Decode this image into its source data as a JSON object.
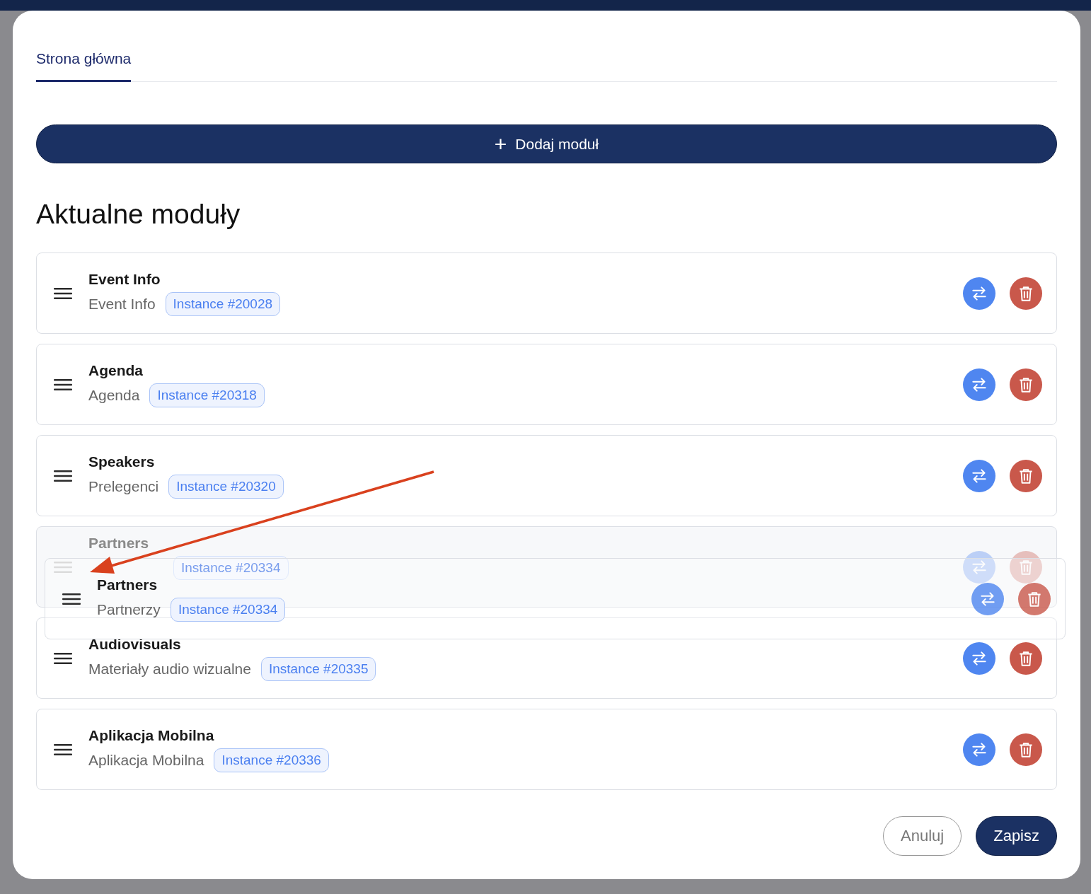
{
  "tabs": [
    {
      "label": "Strona główna",
      "selected": true
    }
  ],
  "add_button": {
    "icon": "+",
    "label": "Dodaj moduł"
  },
  "heading": "Aktualne moduły",
  "modules": [
    {
      "kind": "module",
      "title": "Event Info",
      "subtitle": "Event Info",
      "badge": "Instance #20028"
    },
    {
      "kind": "module",
      "title": "Agenda",
      "subtitle": "Agenda",
      "badge": "Instance #20318"
    },
    {
      "kind": "module",
      "title": "Speakers",
      "subtitle": "Prelegenci",
      "badge": "Instance #20320"
    },
    {
      "kind": "placeholder",
      "title": "Partners",
      "badge": "Instance #20334"
    },
    {
      "kind": "module",
      "title": "Audiovisuals",
      "subtitle": "Materiały audio wizualne",
      "badge": "Instance #20335"
    },
    {
      "kind": "module",
      "title": "Aplikacja Mobilna",
      "subtitle": "Aplikacja Mobilna",
      "badge": "Instance #20336"
    }
  ],
  "drag_ghost": {
    "title": "Partners",
    "subtitle": "Partnerzy",
    "badge": "Instance #20334"
  },
  "footer": {
    "cancel": "Anuluj",
    "save": "Zapisz"
  }
}
